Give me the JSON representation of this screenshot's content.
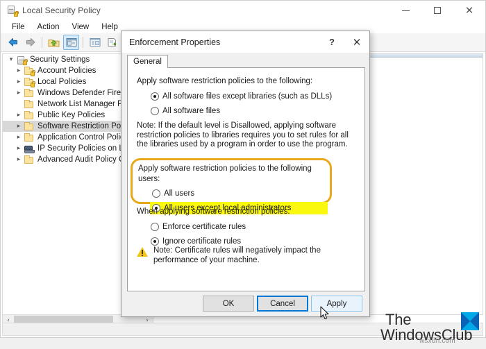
{
  "window": {
    "title": "Local Security Policy",
    "icon": "security-policy-icon",
    "minimize_label": "─",
    "maximize_label": "☐",
    "close_label": "✕"
  },
  "menubar": {
    "items": [
      {
        "label": "File"
      },
      {
        "label": "Action"
      },
      {
        "label": "View"
      },
      {
        "label": "Help"
      }
    ]
  },
  "toolbar": {
    "buttons": [
      {
        "name": "back-arrow-icon",
        "glyph": "←"
      },
      {
        "name": "forward-arrow-icon",
        "glyph": "→"
      },
      {
        "name": "up-folder-icon",
        "glyph": "↑"
      },
      {
        "name": "show-console-tree-icon",
        "glyph": "▤"
      },
      {
        "name": "properties-icon",
        "glyph": "▦"
      },
      {
        "name": "export-list-icon",
        "glyph": "❐"
      },
      {
        "name": "help-icon",
        "glyph": "?"
      }
    ]
  },
  "tree": {
    "root": {
      "label": "Security Settings",
      "icon": "cabinet-lock-icon"
    },
    "items": [
      {
        "label": "Account Policies",
        "icon": "folder-lock-icon",
        "expandable": true,
        "selected": false
      },
      {
        "label": "Local Policies",
        "icon": "folder-lock-icon",
        "expandable": true,
        "selected": false
      },
      {
        "label": "Windows Defender Firewall",
        "icon": "folder-icon",
        "expandable": true,
        "selected": false
      },
      {
        "label": "Network List Manager Polic",
        "icon": "folder-icon",
        "expandable": false,
        "selected": false
      },
      {
        "label": "Public Key Policies",
        "icon": "folder-icon",
        "expandable": true,
        "selected": false
      },
      {
        "label": "Software Restriction Policies",
        "icon": "folder-icon",
        "expandable": true,
        "selected": true
      },
      {
        "label": "Application Control Policies",
        "icon": "folder-icon",
        "expandable": true,
        "selected": false
      },
      {
        "label": "IP Security Policies on Local",
        "icon": "ip-security-icon",
        "expandable": true,
        "selected": false
      },
      {
        "label": "Advanced Audit Policy Con",
        "icon": "folder-icon",
        "expandable": true,
        "selected": false
      }
    ],
    "scrollbar": {
      "left_arrow": "‹",
      "right_arrow": "›"
    }
  },
  "dialog": {
    "title": "Enforcement Properties",
    "help_label": "?",
    "close_label": "✕",
    "tabs": [
      {
        "label": "General",
        "active": true
      }
    ],
    "section_files": {
      "label": "Apply software restriction policies to the following:",
      "options": [
        {
          "label": "All software files except libraries (such as DLLs)",
          "checked": true
        },
        {
          "label": "All software files",
          "checked": false
        }
      ],
      "note": "Note:  If the default level is Disallowed, applying software restriction policies to libraries requires you to set rules for all the libraries used by a program in order to use the program."
    },
    "section_users": {
      "label": "Apply software restriction policies to the following users:",
      "options": [
        {
          "label": "All users",
          "checked": false,
          "highlighted": false
        },
        {
          "label": "All users except local administrators",
          "checked": true,
          "highlighted": true
        }
      ],
      "highlight_color": "#faf80e",
      "callout_border_color": "#e9a81c"
    },
    "section_certs": {
      "label": "When applying software restriction policies:",
      "options": [
        {
          "label": "Enforce certificate rules",
          "checked": false
        },
        {
          "label": "Ignore certificate rules",
          "checked": true
        }
      ]
    },
    "warning": {
      "icon": "warning-triangle-icon",
      "text": "Note:  Certificate rules will negatively impact the performance of your machine."
    },
    "buttons": {
      "ok": "OK",
      "cancel": "Cancel",
      "apply": "Apply"
    }
  },
  "cursor": {
    "name": "mouse-pointer"
  },
  "watermark": {
    "line1": "The",
    "line2": "WindowsClub",
    "sub": "wsxdn.com",
    "logo_color": "#00a8e8"
  }
}
